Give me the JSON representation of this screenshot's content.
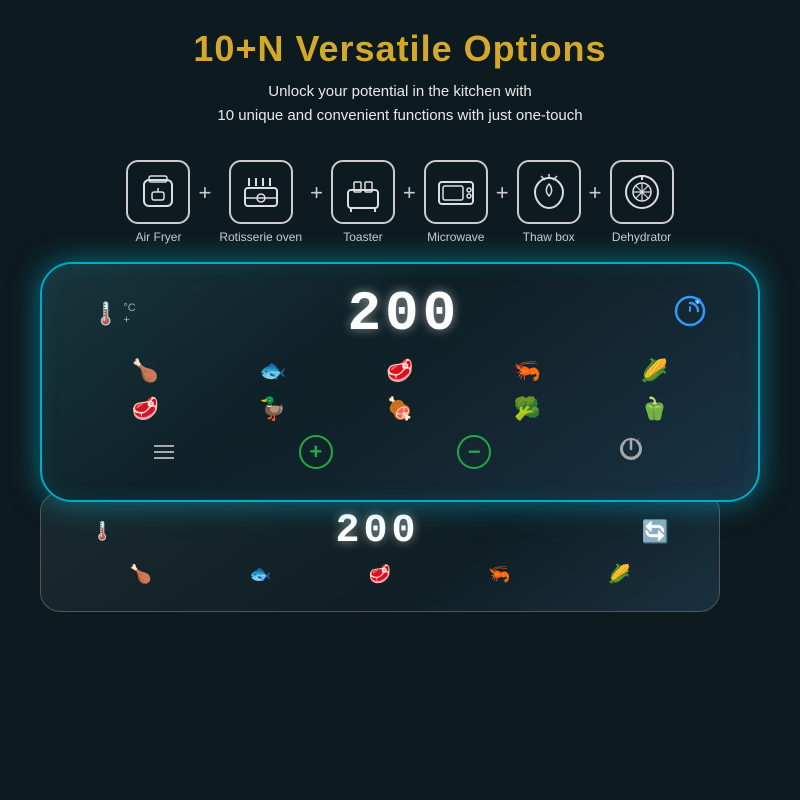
{
  "header": {
    "main_title": "10+N Versatile Options",
    "subtitle_line1": "Unlock your potential in the kitchen with",
    "subtitle_line2": "10 unique and convenient functions with just one-touch"
  },
  "appliances": [
    {
      "id": "air-fryer",
      "label": "Air Fryer",
      "icon": "air-fryer"
    },
    {
      "id": "rotisserie",
      "label": "Rotisserie oven",
      "icon": "rotisserie"
    },
    {
      "id": "toaster",
      "label": "Toaster",
      "icon": "toaster"
    },
    {
      "id": "microwave",
      "label": "Microwave",
      "icon": "microwave"
    },
    {
      "id": "thaw-box",
      "label": "Thaw box",
      "icon": "thaw-box"
    },
    {
      "id": "dehydrator",
      "label": "Dehydrator",
      "icon": "dehydrator"
    }
  ],
  "panel": {
    "temperature": "200",
    "temp_unit": "°C",
    "food_icons_row1": [
      "🍗",
      "🐟",
      "🥩",
      "🦐",
      "🌽"
    ],
    "food_icons_row2": [
      "🥩",
      "🦆",
      "🍖",
      "🥦",
      "🫑"
    ],
    "controls": {
      "menu": "menu",
      "plus": "+",
      "minus": "−",
      "power": "⏻"
    }
  },
  "panel2": {
    "temperature": "200",
    "food_icons": [
      "🍗",
      "🐟",
      "🥩",
      "🦐",
      "🌽"
    ]
  },
  "colors": {
    "title": "#d4a82a",
    "background": "#0d1a1f",
    "panel_border": "#00aacc",
    "text_light": "#e8e8e8",
    "text_dim": "#cccccc"
  }
}
